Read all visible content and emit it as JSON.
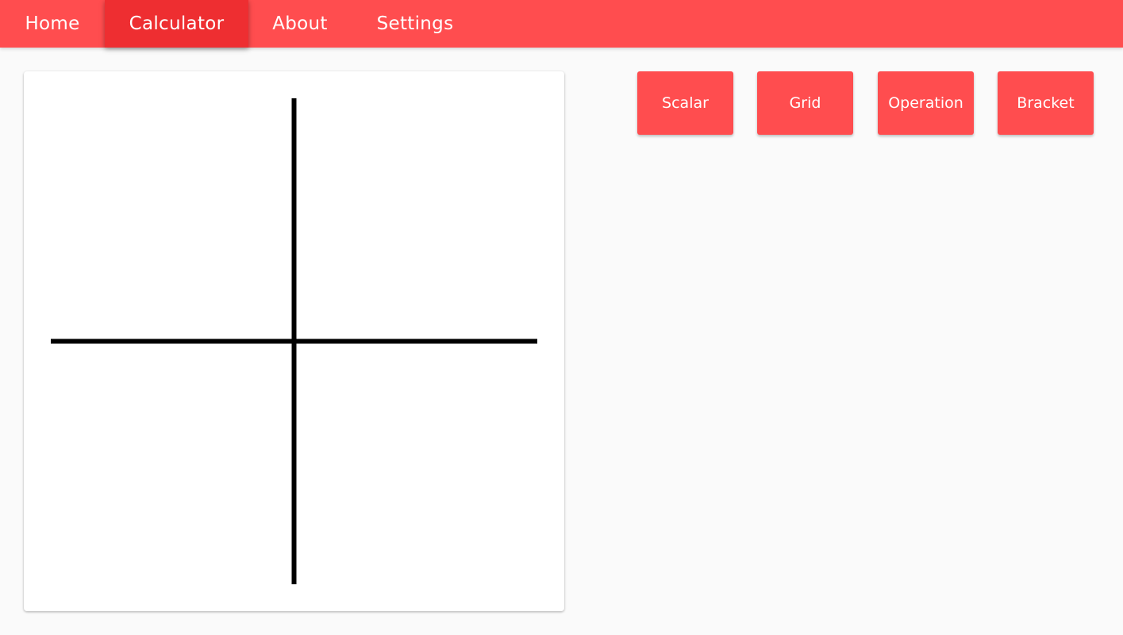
{
  "nav": {
    "items": [
      {
        "label": "Home"
      },
      {
        "label": "Calculator"
      },
      {
        "label": "About"
      },
      {
        "label": "Settings"
      }
    ],
    "active": "Calculator",
    "color": "#ff4d4f",
    "active_color": "#ee2e31"
  },
  "toolbar": {
    "buttons": [
      {
        "label": "Scalar"
      },
      {
        "label": "Grid"
      },
      {
        "label": "Operation"
      },
      {
        "label": "Bracket"
      }
    ],
    "color": "#ff4d4f"
  },
  "canvas": {
    "content": "cross-icon",
    "stroke_color": "#000000"
  }
}
